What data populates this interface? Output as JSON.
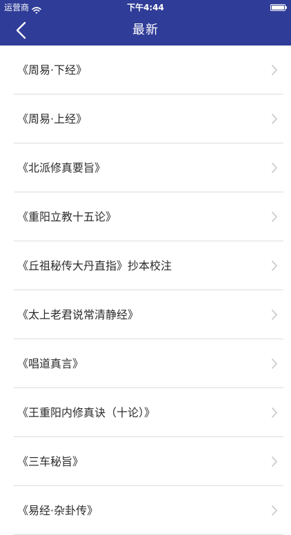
{
  "status_bar": {
    "carrier": "运营商",
    "time": "下午4:44",
    "battery_level": 1.0,
    "wifi_icon": "wifi-icon",
    "battery_icon": "battery-icon"
  },
  "nav": {
    "title": "最新",
    "back_icon": "chevron-left-icon",
    "background_color": "#2f3c98"
  },
  "list": {
    "chevron_icon": "chevron-right-icon",
    "items": [
      {
        "label": "《周易·下经》"
      },
      {
        "label": "《周易·上经》"
      },
      {
        "label": "《北派修真要旨》"
      },
      {
        "label": "《重阳立教十五论》"
      },
      {
        "label": "《丘祖秘传大丹直指》抄本校注"
      },
      {
        "label": "《太上老君说常清静经》"
      },
      {
        "label": "《唱道真言》"
      },
      {
        "label": "《王重阳内修真诀（十论）》"
      },
      {
        "label": "《三车秘旨》"
      },
      {
        "label": "《易经·杂卦传》"
      }
    ]
  }
}
